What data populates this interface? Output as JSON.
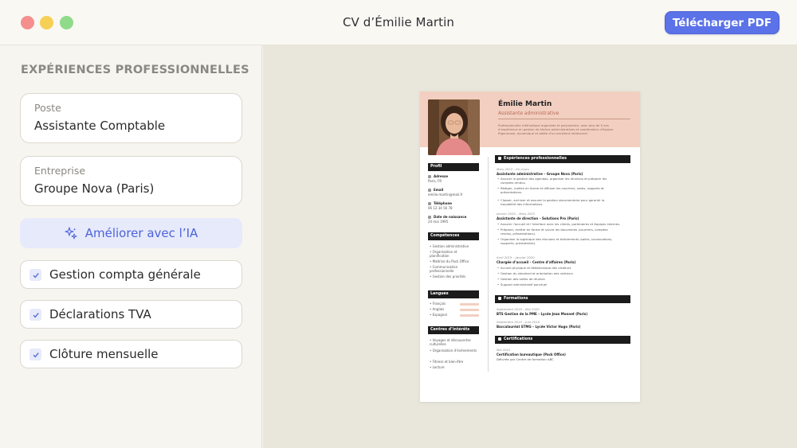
{
  "window": {
    "title": "CV d’Émilie Martin",
    "download_label": "Télécharger PDF",
    "colors": {
      "accent": "#5b72e8",
      "cv_header": "#f2cfc0"
    }
  },
  "editor": {
    "section_title": "EXPÉRIENCES PROFESSIONNELLES",
    "poste_label": "Poste",
    "poste_value": "Assistante Comptable",
    "entreprise_label": "Entreprise",
    "entreprise_value": "Groupe Nova (Paris)",
    "ai_button_label": "Améliorer avec l’IA",
    "tasks": [
      {
        "label": "Gestion compta générale",
        "checked": true
      },
      {
        "label": "Déclarations TVA",
        "checked": true
      },
      {
        "label": "Clôture mensuelle",
        "checked": true
      }
    ]
  },
  "cv": {
    "name": "Émilie Martin",
    "role": "Assistante administrative",
    "summary": [
      "Professionnelle méthodique organisée et polyvalente, avec plus de 5 ans",
      "d’expérience en gestion de tâches administratives et coordination d’équipe.",
      "Rigoureuse, dynamique et dotée d’un excellent relationnel."
    ],
    "profile": {
      "title": "Profil",
      "address_label": "Adresse",
      "address": "Paris, FR",
      "email_label": "Email",
      "email": "emilie.martin@mail.fr",
      "phone_label": "Téléphone",
      "phone": "06 12 34 56 78",
      "birth_label": "Date de naissance",
      "birth": "24 mai 1995"
    },
    "skills": {
      "title": "Compétences",
      "items": [
        "Gestion administrative",
        "Organisation et planification",
        "Maîtrise du Pack Office",
        "Communication professionnelle",
        "Gestion des priorités"
      ]
    },
    "languages": {
      "title": "Langues",
      "items": [
        "Français",
        "Anglais",
        "Espagnol"
      ]
    },
    "interests": {
      "title": "Centres d’intérêts",
      "items": [
        "Voyages et découvertes culturelles",
        "Organisation d’événements",
        "Fitness et bien-être",
        "Lecture"
      ]
    },
    "experience": {
      "title": "Expériences professionnelles",
      "jobs": [
        {
          "date": "Mars 2022 – En cours",
          "title": "Assistante administrative – Groupe Nova (Paris)",
          "bullets": [
            "Assurer la gestion des agendas, organiser les réunions et préparer les",
            "comptes rendus.",
            "Rédiger, mettre en forme et diffuser les courriers, notes, rapports et",
            "présentations.",
            "Classer, archiver et assurer la gestion documentaire pour garantir la",
            "traçabilité des informations."
          ]
        },
        {
          "date": "Janvier 2020 – Mars 2022",
          "title": "Assistante de direction – Solutions Pro (Paris)",
          "bullets": [
            "Assurer l’accueil et l’interface avec les clients, partenaires et équipes internes.",
            "Préparer, mettre en forme et suivre les documents (courriers, comptes",
            "rendus, présentations).",
            "Organiser la logistique des réunions et événements (salles, convocations,",
            "supports, prestataires)."
          ]
        },
        {
          "date": "Avril 2019 – Janvier 2020",
          "title": "Chargée d’accueil – Centre d’affaires (Paris)",
          "bullets": [
            "Accueil physique et téléphonique des visiteurs",
            "Gestion du standard et orientation des visiteurs",
            "Gestion des salles de réunion",
            "Support administratif ponctuel"
          ]
        }
      ]
    },
    "education": {
      "title": "Formations",
      "items": [
        {
          "date": "Septembre 2018 – Mai 2020",
          "title": "BTS Gestion de la PME – Lycée Jean Monnet (Paris)"
        },
        {
          "date": "Septembre 2015 – Juin 2018",
          "title": "Baccalauréat STMG – Lycée Victor Hugo (Paris)"
        }
      ]
    },
    "certifications": {
      "title": "Certifications",
      "items": [
        {
          "date": "Mai 2021",
          "title": "Certification bureautique (Pack Office)",
          "org": "Délivrée par Centre de formation ABC"
        }
      ]
    }
  }
}
